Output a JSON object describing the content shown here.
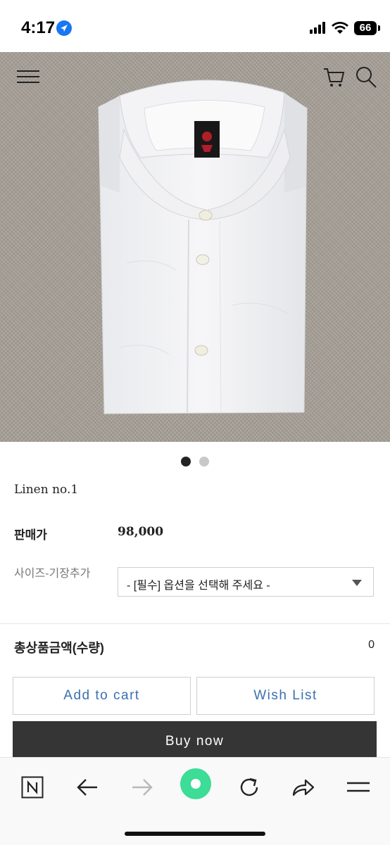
{
  "status_bar": {
    "time": "4:17",
    "battery": "66"
  },
  "product": {
    "name": "Linen no.1",
    "price_label": "판매가",
    "price_value": "98,000"
  },
  "carousel": {
    "total": 2,
    "active_index": 1
  },
  "option": {
    "label": "사이즈-기장추가",
    "selected": "- [필수] 옵션을 선택해 주세요 -"
  },
  "total": {
    "label": "총상품금액(수량)",
    "value": "0"
  },
  "buttons": {
    "add_to_cart": "Add to cart",
    "wish_list": "Wish List",
    "buy_now": "Buy now"
  },
  "toolbar": {
    "icons": [
      "n-logo-icon",
      "back-arrow-icon",
      "forward-arrow-icon",
      "green-dot-icon",
      "reload-icon",
      "share-icon",
      "menu-icon"
    ],
    "accent": "#3ddc97"
  }
}
